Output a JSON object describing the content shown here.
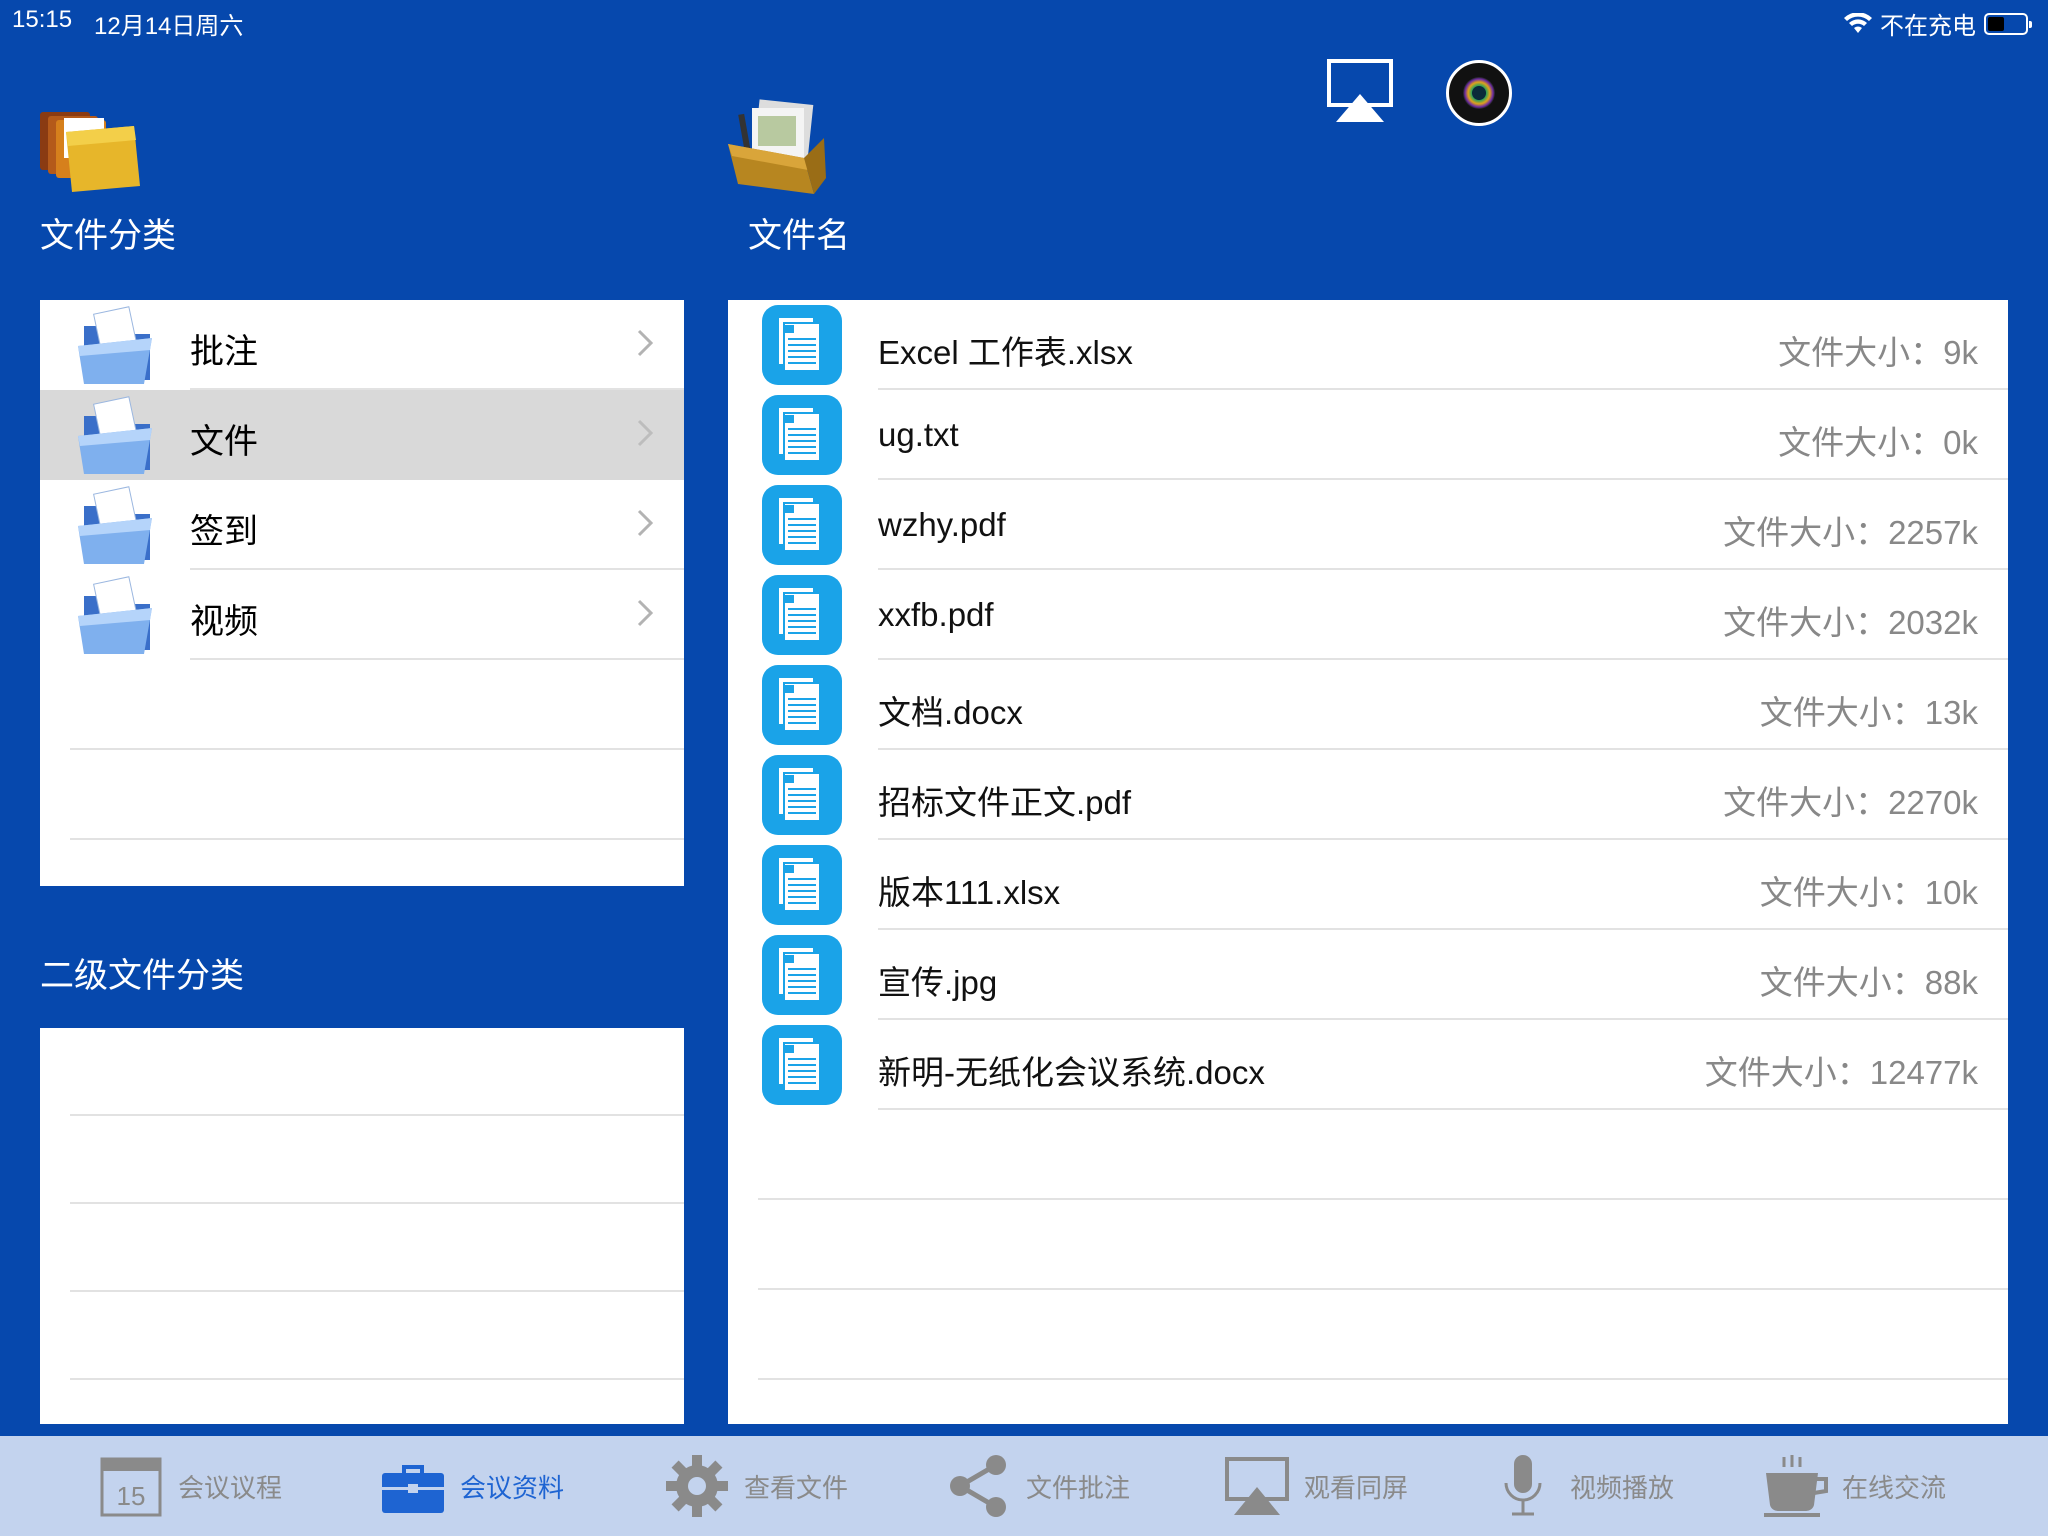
{
  "status_bar": {
    "time": "15:15",
    "date": "12月14日周六",
    "charging_status": "不在充电"
  },
  "header": {
    "category_title": "文件分类",
    "filename_title": "文件名"
  },
  "categories": [
    {
      "label": "批注",
      "selected": false
    },
    {
      "label": "文件",
      "selected": true
    },
    {
      "label": "签到",
      "selected": false
    },
    {
      "label": "视频",
      "selected": false
    }
  ],
  "secondary_title": "二级文件分类",
  "files": [
    {
      "name": "Excel 工作表.xlsx",
      "size": "文件大小：9k"
    },
    {
      "name": "ug.txt",
      "size": "文件大小：0k"
    },
    {
      "name": "wzhy.pdf",
      "size": "文件大小：2257k"
    },
    {
      "name": "xxfb.pdf",
      "size": "文件大小：2032k"
    },
    {
      "name": "文档.docx",
      "size": "文件大小：13k"
    },
    {
      "name": "招标文件正文.pdf",
      "size": "文件大小：2270k"
    },
    {
      "name": "版本111.xlsx",
      "size": "文件大小：10k"
    },
    {
      "name": "宣传.jpg",
      "size": "文件大小：88k"
    },
    {
      "name": "新明-无纸化会议系统.docx",
      "size": "文件大小：12477k"
    }
  ],
  "tabs": [
    {
      "label": "会议议程",
      "icon": "calendar-icon",
      "calendar_day": "15",
      "active": false
    },
    {
      "label": "会议资料",
      "icon": "briefcase-icon",
      "active": true
    },
    {
      "label": "查看文件",
      "icon": "gear-icon",
      "active": false
    },
    {
      "label": "文件批注",
      "icon": "share-icon",
      "active": false
    },
    {
      "label": "观看同屏",
      "icon": "airplay-icon",
      "active": false
    },
    {
      "label": "视频播放",
      "icon": "microphone-icon",
      "active": false
    },
    {
      "label": "在线交流",
      "icon": "coffee-cup-icon",
      "active": false
    }
  ],
  "colors": {
    "background": "#0648AD",
    "tabbar": "#C3D3EE",
    "active_tab": "#1E64D2",
    "selected_row": "#D9D9D9",
    "file_icon": "#1AA3E8"
  }
}
